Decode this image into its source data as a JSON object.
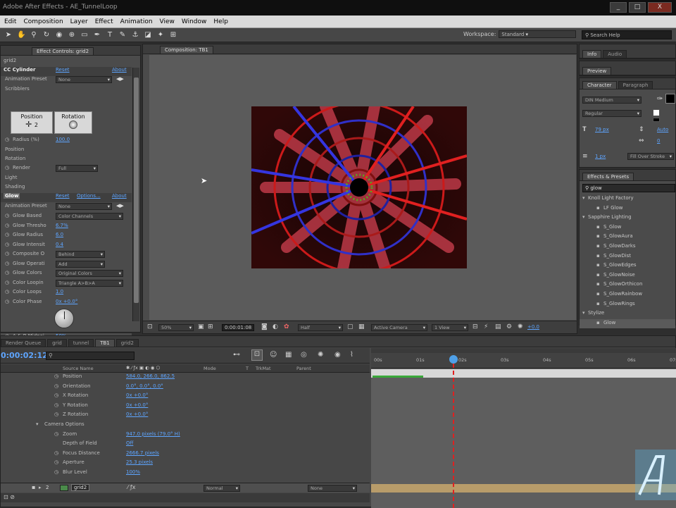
{
  "window": {
    "title": "Adobe After Effects - AE_TunnelLoop",
    "controls": [
      "_",
      "□",
      "X"
    ]
  },
  "menu": [
    "Edit",
    "Composition",
    "Layer",
    "Effect",
    "Animation",
    "View",
    "Window",
    "Help"
  ],
  "toolbar": {
    "workspace_label": "Workspace:",
    "workspace_value": "Standard",
    "search_placeholder": "Search Help"
  },
  "left_panel": {
    "tabs": [
      "Effect Controls: grid2"
    ],
    "layer_name": "grid2",
    "cc_cylinder": {
      "name": "CC Cylinder",
      "reset": "Reset",
      "about": "About",
      "animation_preset_label": "Animation Preset",
      "animation_preset_value": "None",
      "scribblers": "Scribblers",
      "position_btn": "Position",
      "rotation_btn": "Rotation",
      "position_val": "2",
      "radius_label": "Radius (%)",
      "radius_val": "100.0",
      "position": "Position",
      "rotation": "Rotation",
      "render_label": "Render",
      "render_val": "Full",
      "light": "Light",
      "shading": "Shading"
    },
    "glow": {
      "name": "Glow",
      "reset": "Reset",
      "options": "Options...",
      "about": "About",
      "animation_preset_label": "Animation Preset",
      "animation_preset_value": "None",
      "props": [
        {
          "label": "Glow Based",
          "value": "Color Channels",
          "kind": "dropdown"
        },
        {
          "label": "Glow Thresho",
          "value": "6.7%",
          "kind": "value"
        },
        {
          "label": "Glow Radius",
          "value": "6.0",
          "kind": "value"
        },
        {
          "label": "Glow Intensit",
          "value": "0.4",
          "kind": "value"
        },
        {
          "label": "Composite O",
          "value": "Behind",
          "kind": "dropdown"
        },
        {
          "label": "Glow Operati",
          "value": "Add",
          "kind": "dropdown"
        },
        {
          "label": "Glow Colors",
          "value": "Original Colors",
          "kind": "dropdown"
        },
        {
          "label": "Color Loopin",
          "value": "Triangle A>B>A",
          "kind": "dropdown"
        },
        {
          "label": "Color Loops",
          "value": "1.0",
          "kind": "value"
        },
        {
          "label": "Color Phase",
          "value": "0x +0.0°",
          "kind": "value"
        }
      ],
      "ab_mid_label": "A & B Midpoi",
      "ab_mid_val": "50%"
    }
  },
  "composition": {
    "tab": "Composition: TB1",
    "zoom": "50%",
    "timecode": "0:00:01:08",
    "resolution": "Half",
    "camera": "Active Camera",
    "view": "1 View",
    "exposure": "+0.0"
  },
  "right_panel": {
    "tabs_top": [
      "Info",
      "Audio"
    ],
    "preview_tab": "Preview",
    "char_tabs": [
      "Character",
      "Paragraph"
    ],
    "font": "DIN Medium",
    "style": "Regular",
    "size": "79 px",
    "leading": "Auto",
    "tracking": "0",
    "stroke_w": "1 px",
    "stroke_type": "Fill Over Stroke",
    "fx_tab": "Effects & Presets",
    "search": "glow",
    "tree": [
      {
        "t": "Knoll Light Factory",
        "indent": 0,
        "folder": true
      },
      {
        "t": "LF Glow",
        "indent": 1,
        "folder": false
      },
      {
        "t": "Sapphire Lighting",
        "indent": 0,
        "folder": true
      },
      {
        "t": "S_Glow",
        "indent": 1,
        "folder": false
      },
      {
        "t": "S_GlowAura",
        "indent": 1,
        "folder": false
      },
      {
        "t": "S_GlowDarks",
        "indent": 1,
        "folder": false
      },
      {
        "t": "S_GlowDist",
        "indent": 1,
        "folder": false
      },
      {
        "t": "S_GlowEdges",
        "indent": 1,
        "folder": false
      },
      {
        "t": "S_GlowNoise",
        "indent": 1,
        "folder": false
      },
      {
        "t": "S_GlowOrthicon",
        "indent": 1,
        "folder": false
      },
      {
        "t": "S_GlowRainbow",
        "indent": 1,
        "folder": false
      },
      {
        "t": "S_GlowRings",
        "indent": 1,
        "folder": false
      },
      {
        "t": "Stylize",
        "indent": 0,
        "folder": true
      },
      {
        "t": "Glow",
        "indent": 1,
        "folder": false
      }
    ]
  },
  "timeline": {
    "tabs": [
      "Render Queue",
      "grid",
      "tunnel",
      "TB1",
      "grid2"
    ],
    "active_tab": "TB1",
    "time": "0:00:02:12",
    "col_source": "Source Name",
    "col_mode": "Mode",
    "col_t": "T",
    "col_trkmat": "TrkMat",
    "col_parent": "Parent",
    "ruler": [
      "00s",
      "01s",
      "02s",
      "03s",
      "04s",
      "05s",
      "06s",
      "07s"
    ],
    "current_time_fraction": 0.27,
    "rows": [
      {
        "label": "Position",
        "value": "584.0, 266.0, 862.5",
        "indent": 2,
        "sw": true
      },
      {
        "label": "Orientation",
        "value": "0.0°, 0.0°, 0.0°",
        "indent": 2,
        "sw": true
      },
      {
        "label": "X Rotation",
        "value": "0x +0.0°",
        "indent": 2,
        "sw": true
      },
      {
        "label": "Y Rotation",
        "value": "0x +0.0°",
        "indent": 2,
        "sw": true
      },
      {
        "label": "Z Rotation",
        "value": "0x +0.0°",
        "indent": 2,
        "sw": true
      },
      {
        "label": "Camera Options",
        "value": "",
        "indent": 1,
        "sw": false
      },
      {
        "label": "Zoom",
        "value": "947.0 pixels (79.0° H)",
        "indent": 2,
        "sw": true
      },
      {
        "label": "Depth of Field",
        "value": "Off",
        "indent": 2,
        "sw": false
      },
      {
        "label": "Focus Distance",
        "value": "2666.7 pixels",
        "indent": 2,
        "sw": true
      },
      {
        "label": "Aperture",
        "value": "25.3 pixels",
        "indent": 2,
        "sw": true
      },
      {
        "label": "Blur Level",
        "value": "100%",
        "indent": 2,
        "sw": true
      }
    ],
    "layer": {
      "num": "2",
      "name": "grid2",
      "mode": "Normal",
      "parent": "None"
    }
  }
}
